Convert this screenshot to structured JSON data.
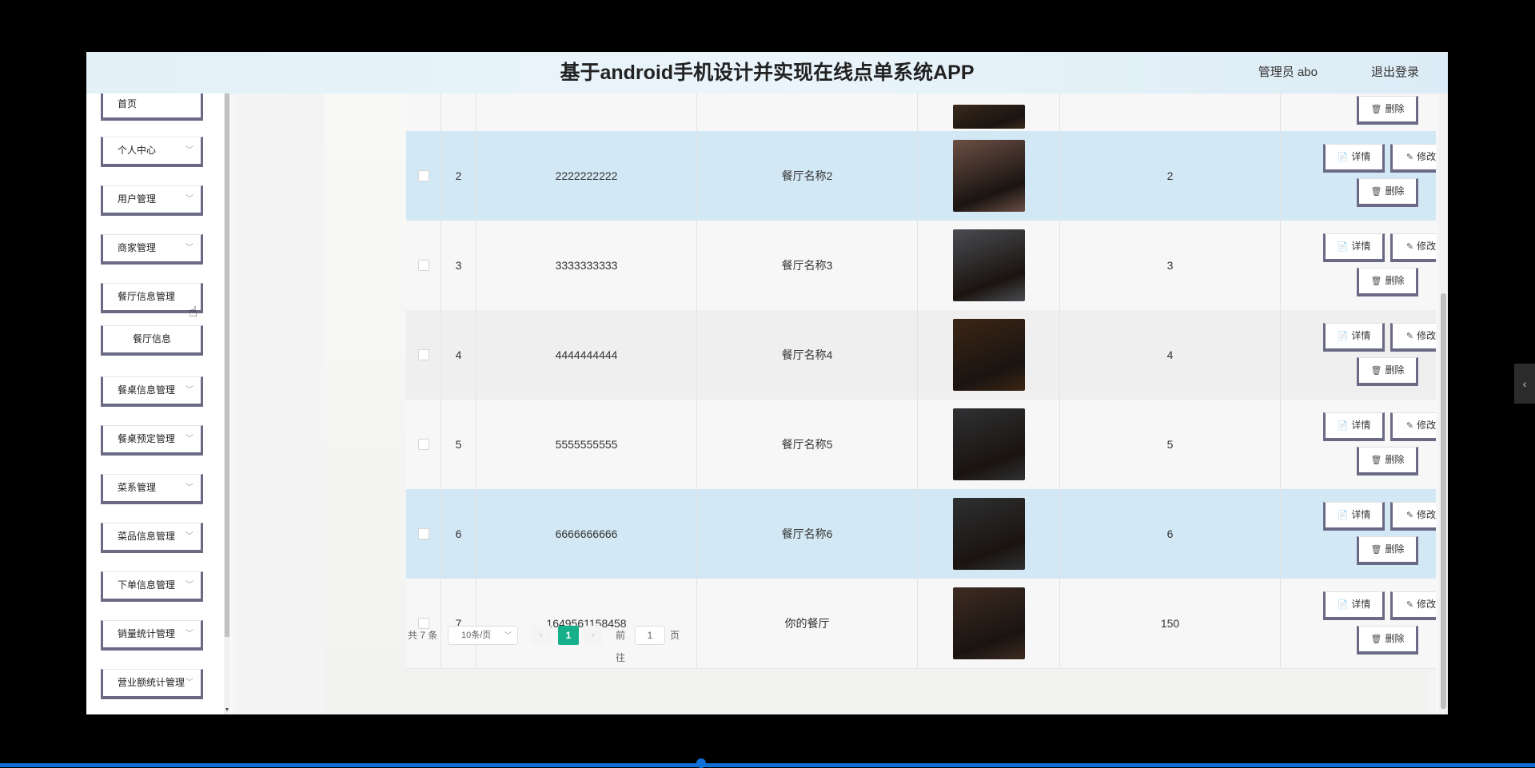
{
  "header": {
    "title": "基于android手机设计并实现在线点单系统APP",
    "user": "管理员 abo",
    "logout": "退出登录"
  },
  "sidebar": {
    "items": [
      {
        "label": "首页",
        "chevron": ""
      },
      {
        "label": "个人中心",
        "chevron": "﹀"
      },
      {
        "label": "用户管理",
        "chevron": "﹀"
      },
      {
        "label": "商家管理",
        "chevron": "﹀"
      },
      {
        "label": "餐厅信息管理",
        "chevron": ""
      },
      {
        "label": "餐厅信息",
        "chevron": ""
      },
      {
        "label": "餐桌信息管理",
        "chevron": "﹀"
      },
      {
        "label": "餐桌预定管理",
        "chevron": "﹀"
      },
      {
        "label": "菜系管理",
        "chevron": "﹀"
      },
      {
        "label": "菜品信息管理",
        "chevron": "﹀"
      },
      {
        "label": "下单信息管理",
        "chevron": "﹀"
      },
      {
        "label": "销量统计管理",
        "chevron": "﹀"
      },
      {
        "label": "营业额统计管理",
        "chevron": "﹀"
      }
    ]
  },
  "actions": {
    "detail": "详情",
    "edit": "修改",
    "delete": "删除",
    "detail_icon": "📄",
    "edit_icon": "✎",
    "delete_icon": "🗑"
  },
  "table": {
    "rows": [
      {
        "index": "",
        "account": "",
        "name": "",
        "value": "",
        "img": "#3a2a1c",
        "highlight": false,
        "partial": true
      },
      {
        "index": "2",
        "account": "2222222222",
        "name": "餐厅名称2",
        "value": "2",
        "img": "#6b4f45",
        "highlight": true
      },
      {
        "index": "3",
        "account": "3333333333",
        "name": "餐厅名称3",
        "value": "3",
        "img": "#4a4c52",
        "highlight": false
      },
      {
        "index": "4",
        "account": "4444444444",
        "name": "餐厅名称4",
        "value": "4",
        "img": "#3b2616",
        "highlight": false,
        "alt": true
      },
      {
        "index": "5",
        "account": "5555555555",
        "name": "餐厅名称5",
        "value": "5",
        "img": "#2f3133",
        "highlight": false
      },
      {
        "index": "6",
        "account": "6666666666",
        "name": "餐厅名称6",
        "value": "6",
        "img": "#2e3032",
        "highlight": true
      },
      {
        "index": "7",
        "account": "1649561158458",
        "name": "你的餐厅",
        "value": "150",
        "img": "#3d2b22",
        "highlight": false
      }
    ]
  },
  "pagination": {
    "total": "共 7 条",
    "page_size": "10条/页",
    "prev": "‹",
    "next": "›",
    "current": "1",
    "goto": "前往",
    "goto_value": "1",
    "page_unit": "页"
  },
  "colors": {
    "highlight_row": "#d3e8f5",
    "normal_row": "#f7f7f7",
    "alt_row": "#efefef",
    "active_page": "#16b08a",
    "button_border": "#6a6a86"
  }
}
